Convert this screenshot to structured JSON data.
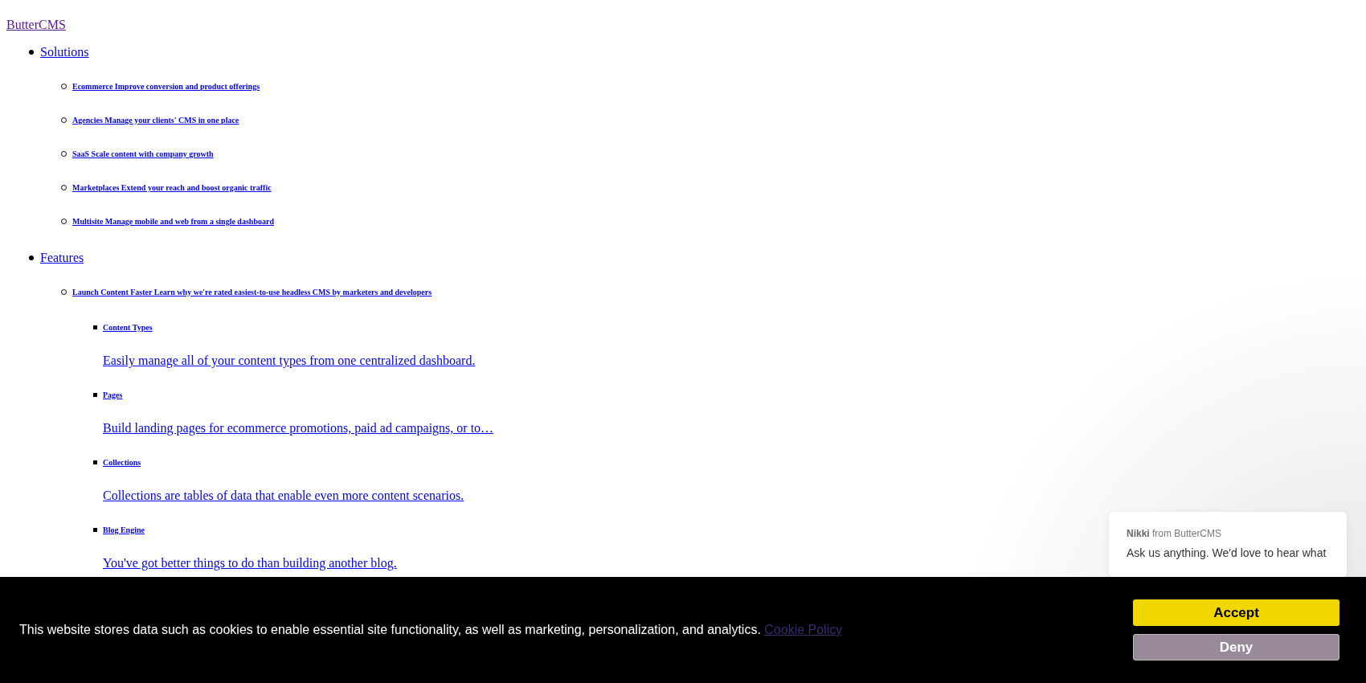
{
  "logo_link": "ButterCMS",
  "nav": [
    {
      "label": "Solutions",
      "children": [
        {
          "label": "Ecommerce Improve conversion and product offerings"
        },
        {
          "label": "Agencies Manage your clients' CMS in one place"
        },
        {
          "label": "SaaS Scale content with company growth"
        },
        {
          "label": "Marketplaces Extend your reach and boost organic traffic"
        },
        {
          "label": "Multisite Manage mobile and web from a single dashboard"
        }
      ]
    },
    {
      "label": "Features",
      "children": [
        {
          "label": "Launch Content Faster Learn why we're rated easiest-to-use headless CMS by marketers and developers",
          "children": [
            {
              "label": "Content Types",
              "description": "Easily manage all of your content types from one centralized dashboard."
            },
            {
              "label": "Pages",
              "description": "Build landing pages for ecommerce promotions, paid ad campaigns, or to…"
            },
            {
              "label": "Collections",
              "description": "Collections are tables of data that enable even more content scenarios."
            },
            {
              "label": "Blog Engine",
              "description": "You've got better things to do than building another blog."
            }
          ]
        }
      ]
    }
  ],
  "chat_popup": {
    "sender": "Nikki",
    "from_text": "from ButterCMS",
    "message": "Ask us anything. We'd love to hear what"
  },
  "cookie_banner": {
    "text": "This website stores data such as cookies to enable essential site functionality, as well as marketing, personalization, and analytics.",
    "link": "Cookie Policy",
    "buttons": [
      {
        "label": "Accept",
        "kind": "primary"
      },
      {
        "label": "Deny",
        "kind": "secondary"
      }
    ]
  }
}
